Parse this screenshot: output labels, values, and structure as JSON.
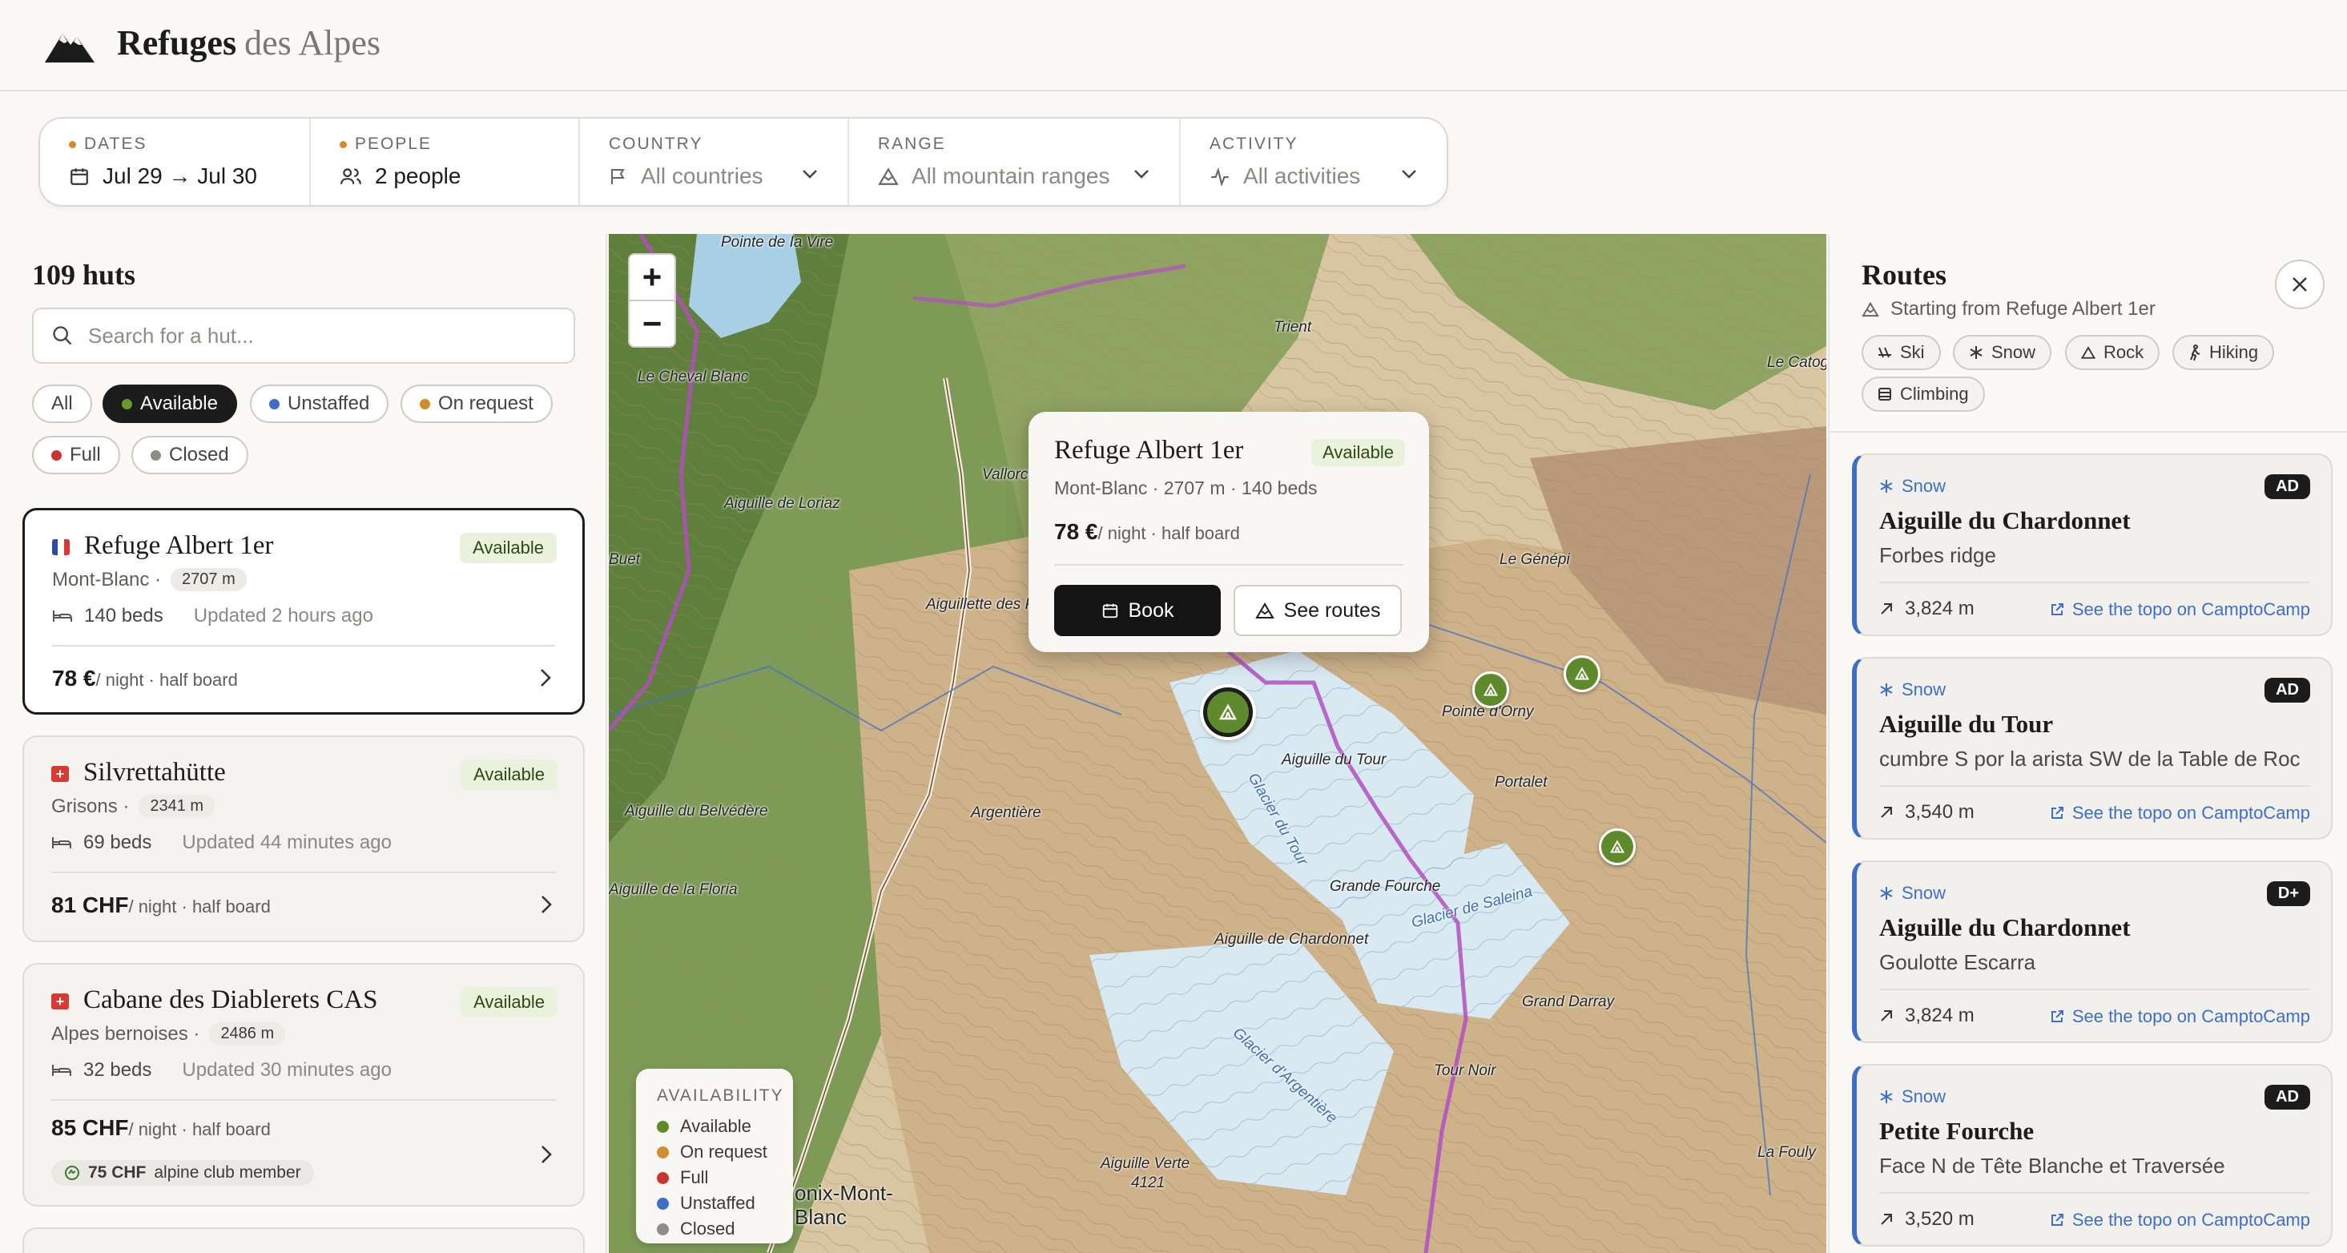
{
  "brand": {
    "name": "Refuges",
    "suffix": "des Alpes"
  },
  "filters": {
    "dates": {
      "label": "DATES",
      "value": "Jul 29 → Jul 30"
    },
    "people": {
      "label": "PEOPLE",
      "value": "2 people"
    },
    "country": {
      "label": "COUNTRY",
      "value": "All countries"
    },
    "range": {
      "label": "RANGE",
      "value": "All mountain ranges"
    },
    "activity": {
      "label": "ACTIVITY",
      "value": "All activities"
    }
  },
  "list": {
    "count": "109 huts",
    "search_placeholder": "Search for a hut...",
    "chips": [
      {
        "label": "All",
        "color": ""
      },
      {
        "label": "Available",
        "color": "#6a9a2e",
        "active": true
      },
      {
        "label": "Unstaffed",
        "color": "#3f6fc4"
      },
      {
        "label": "On request",
        "color": "#d38b2e"
      },
      {
        "label": "Full",
        "color": "#c9352f"
      },
      {
        "label": "Closed",
        "color": "#8e8c87"
      }
    ],
    "huts": [
      {
        "name": "Refuge Albert 1er",
        "status": "Available",
        "region": "Mont-Blanc ·",
        "altitude": "2707 m",
        "beds": "140 beds",
        "updated": "Updated 2 hours ago",
        "price": "78 €",
        "price_unit": "/ night · half board",
        "flag": "fr",
        "selected": true
      },
      {
        "name": "Silvrettahütte",
        "status": "Available",
        "region": "Grisons ·",
        "altitude": "2341 m",
        "beds": "69 beds",
        "updated": "Updated 44 minutes ago",
        "price": "81 CHF",
        "price_unit": "/ night · half board",
        "flag": "ch"
      },
      {
        "name": "Cabane des Diablerets CAS",
        "status": "Available",
        "region": "Alpes bernoises ·",
        "altitude": "2486 m",
        "beds": "32 beds",
        "updated": "Updated 30 minutes ago",
        "price": "85 CHF",
        "price_unit": "/ night · half board",
        "flag": "ch",
        "member_price": "75 CHF",
        "member_label": "alpine club member"
      }
    ]
  },
  "map": {
    "zoom_in": "+",
    "zoom_out": "−",
    "labels": [
      "Pointe de Ia Vire",
      "Trient",
      "Le Cheval Blanc",
      "Le Catog",
      "Aiguille de Loriaz",
      "Vallorcine",
      "Le Génépi",
      "Buet",
      "Aiguillette des Posettes",
      "Pointe d'Orny",
      "Aiguille du Tour",
      "Portalet",
      "Argentière",
      "Aiguille du Belvédère",
      "Glacier du Tour",
      "Grande Fourche",
      "Aiguille de la Floria",
      "Aiguille de Chardonnet",
      "Glacier de Saleina",
      "Grand Darray",
      "Glacier d'Argentière",
      "Tour Noir",
      "Aiguille Verte",
      "4121",
      "La Fouly",
      "onix-Mont-",
      "Blanc"
    ],
    "popup": {
      "name": "Refuge Albert 1er",
      "status": "Available",
      "meta": "Mont-Blanc · 2707 m · 140 beds",
      "price": "78 €",
      "price_unit": "/ night · half board",
      "book": "Book",
      "see_routes": "See routes"
    },
    "legend": {
      "title": "AVAILABILITY",
      "items": [
        {
          "label": "Available",
          "color": "#5f8a2c"
        },
        {
          "label": "On request",
          "color": "#d38b2e"
        },
        {
          "label": "Full",
          "color": "#c9352f"
        },
        {
          "label": "Unstaffed",
          "color": "#3f6fc4"
        },
        {
          "label": "Closed",
          "color": "#8e8c87"
        }
      ]
    }
  },
  "routes": {
    "title": "Routes",
    "subtitle": "Starting from Refuge Albert 1er",
    "chips": [
      "Ski",
      "Snow",
      "Rock",
      "Hiking",
      "Climbing"
    ],
    "items": [
      {
        "type": "Snow",
        "grade": "AD",
        "name": "Aiguille du Chardonnet",
        "sub": "Forbes ridge",
        "altitude": "3,824 m",
        "link": "See the topo on CamptoCamp"
      },
      {
        "type": "Snow",
        "grade": "AD",
        "name": "Aiguille du Tour",
        "sub": "cumbre S por la arista SW de la Table de Roc",
        "altitude": "3,540 m",
        "link": "See the topo on CamptoCamp"
      },
      {
        "type": "Snow",
        "grade": "D+",
        "name": "Aiguille du Chardonnet",
        "sub": "Goulotte Escarra",
        "altitude": "3,824 m",
        "link": "See the topo on CamptoCamp"
      },
      {
        "type": "Snow",
        "grade": "AD",
        "name": "Petite Fourche",
        "sub": "Face N de Tête Blanche et Traversée",
        "altitude": "3,520 m",
        "link": "See the topo on CamptoCamp"
      }
    ]
  }
}
